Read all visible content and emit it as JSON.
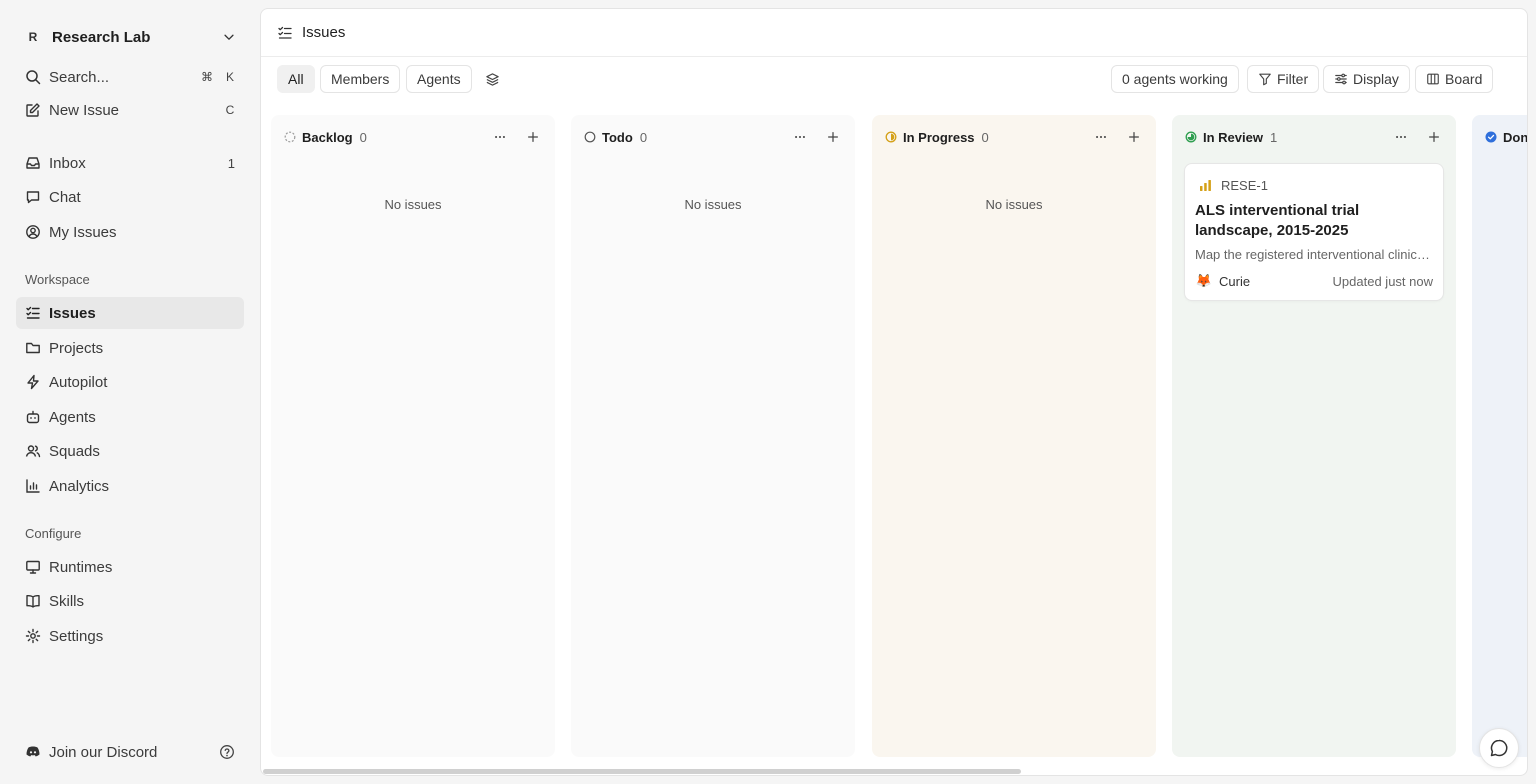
{
  "workspace": {
    "avatar": "R",
    "name": "Research Lab"
  },
  "sidebar": {
    "search": {
      "label": "Search...",
      "shortcut_mod": "⌘",
      "shortcut_key": "K"
    },
    "new_issue": {
      "label": "New Issue",
      "shortcut": "C"
    },
    "inbox": {
      "label": "Inbox",
      "count": "1"
    },
    "chat": {
      "label": "Chat"
    },
    "my_issues": {
      "label": "My Issues"
    },
    "workspace_label": "Workspace",
    "workspace_items": [
      {
        "label": "Issues",
        "icon": "issues-icon",
        "active": true
      },
      {
        "label": "Projects",
        "icon": "folder-icon"
      },
      {
        "label": "Autopilot",
        "icon": "bolt-icon"
      },
      {
        "label": "Agents",
        "icon": "bot-icon"
      },
      {
        "label": "Squads",
        "icon": "users-icon"
      },
      {
        "label": "Analytics",
        "icon": "bar-chart-icon"
      }
    ],
    "configure_label": "Configure",
    "configure_items": [
      {
        "label": "Runtimes",
        "icon": "monitor-icon"
      },
      {
        "label": "Skills",
        "icon": "book-icon"
      },
      {
        "label": "Settings",
        "icon": "gear-icon"
      }
    ],
    "discord": {
      "label": "Join our Discord"
    }
  },
  "header": {
    "title": "Issues"
  },
  "toolbar": {
    "tabs": [
      "All",
      "Members",
      "Agents"
    ],
    "agents_working": "0 agents working",
    "filter": "Filter",
    "display": "Display",
    "board": "Board"
  },
  "columns": [
    {
      "name": "Backlog",
      "count": "0",
      "empty_text": "No issues",
      "bg": "#fafafa",
      "status_color": "#9a9a9a"
    },
    {
      "name": "Todo",
      "count": "0",
      "empty_text": "No issues",
      "bg": "#fafafa",
      "status_color": "#555555"
    },
    {
      "name": "In Progress",
      "count": "0",
      "empty_text": "No issues",
      "bg": "#faf6ef",
      "status_color": "#d4a017"
    },
    {
      "name": "In Review",
      "count": "1",
      "bg": "#f1f5f1",
      "status_color": "#2e9e4f"
    },
    {
      "name": "Done",
      "bg": "#eef2f8",
      "status_color": "#2f6fdb"
    }
  ],
  "card": {
    "id": "RESE-1",
    "title": "ALS interventional trial landscape, 2015-2025",
    "description": "Map the registered interventional clinical trials",
    "assignee_avatar": "🦊",
    "assignee": "Curie",
    "updated": "Updated just now"
  },
  "colors": {
    "accent_green": "#2e9e4f",
    "accent_yellow": "#d4a017",
    "accent_blue": "#2f6fdb"
  }
}
